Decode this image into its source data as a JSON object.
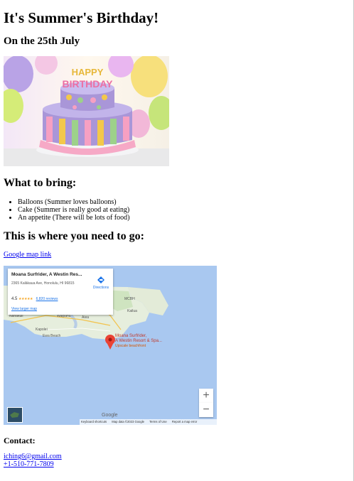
{
  "header": {
    "title": "It's Summer's Birthday!",
    "subtitle": "On the 25th July"
  },
  "cake_image": {
    "topper_line1": "HAPPY",
    "topper_line2": "BIRTHDAY"
  },
  "bring": {
    "heading": "What to bring:",
    "items": [
      "Balloons (Summer loves balloons)",
      "Cake (Summer is really good at eating)",
      "An appetite (There will be lots of food)"
    ]
  },
  "location": {
    "heading": "This is where you need to go:",
    "map_link": "Google map link"
  },
  "map": {
    "place_title": "Moana Surfrider, A Westin Res...",
    "address": "2365 Kalākaua Ave, Honolulu, HI 96815",
    "rating": "4.5",
    "reviews": "6,820 reviews",
    "directions": "Directions",
    "larger_map": "View larger map",
    "pin_label_line1": "Moana Surfrider,",
    "pin_label_line2": "A Westin Resort & Spa...",
    "pin_sub": "Upscale beachfront",
    "zoom_in": "+",
    "zoom_out": "−",
    "brand": "Google",
    "places": {
      "mcbh": "MCBH",
      "kailua": "Kailua",
      "waipahu": "Waipahu",
      "aiea": "Aiea",
      "kapolei": "Kapolei",
      "ewa_beach": "Ewa Beach",
      "nanakuli": "Nanakuli"
    },
    "attribution": {
      "shortcuts": "Keyboard shortcuts",
      "data": "Map data ©2023 Google",
      "terms": "Terms of Use",
      "report": "Report a map error"
    },
    "colors": {
      "ocean": "#a9c8f0",
      "land": "#e8efe0",
      "pin": "#ea4335"
    }
  },
  "contact": {
    "heading": "Contact:",
    "email": "iching6@gmail.com",
    "phone": "+1-510-771-7809"
  }
}
